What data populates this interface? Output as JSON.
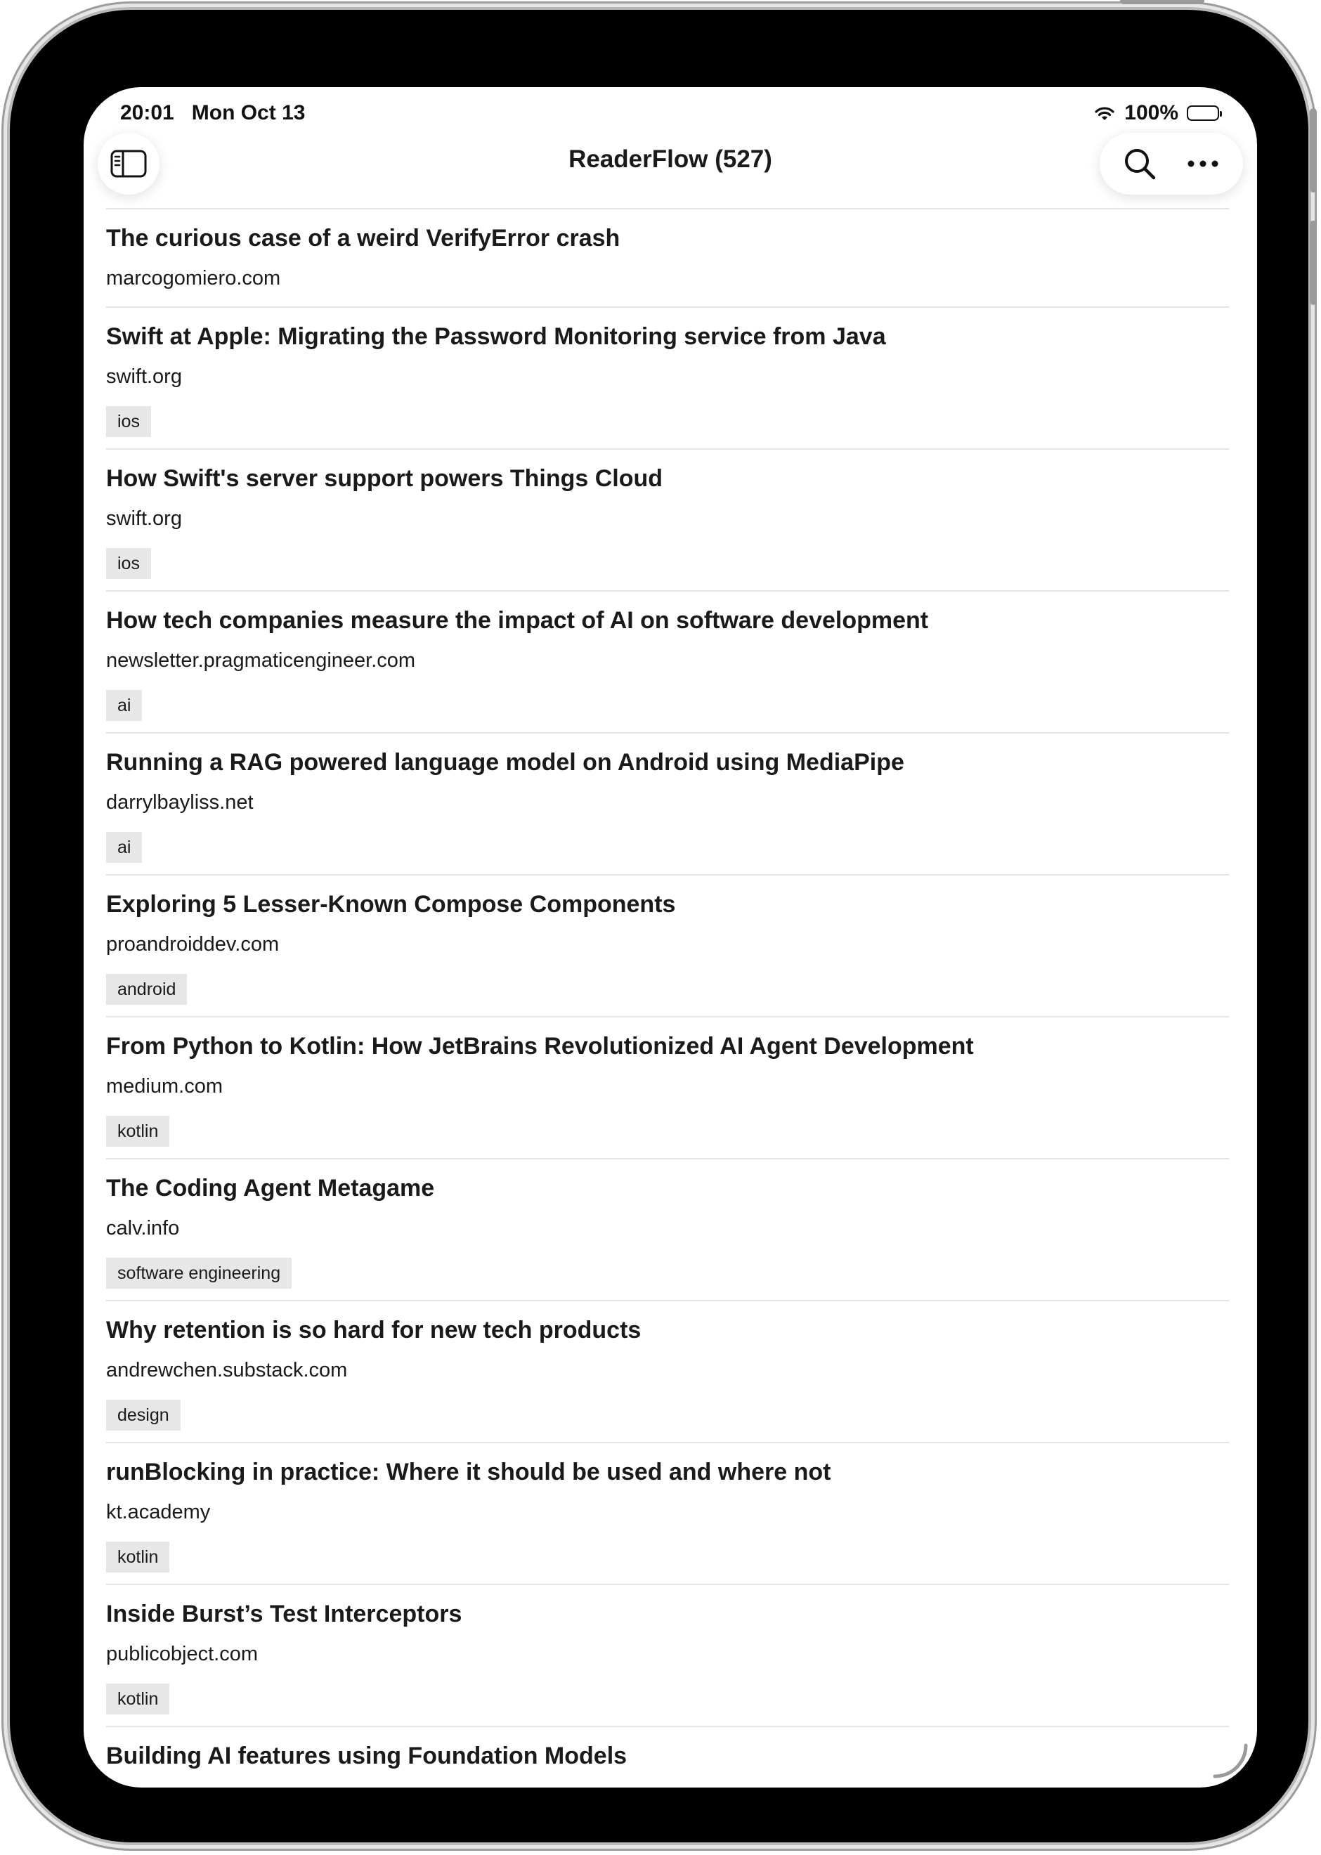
{
  "status_bar": {
    "time": "20:01",
    "date": "Mon Oct 13",
    "battery": "100%",
    "icons": [
      "wifi-icon",
      "battery-icon"
    ]
  },
  "toolbar": {
    "title": "ReaderFlow (527)",
    "buttons": [
      "sidebar-toggle-icon",
      "search-icon",
      "more-icon"
    ]
  },
  "articles": [
    {
      "title": "The curious case of a weird VerifyError crash",
      "domain": "marcogomiero.com"
    },
    {
      "title": "Swift at Apple: Migrating the Password Monitoring service from Java",
      "domain": "swift.org",
      "tag": "ios"
    },
    {
      "title": "How Swift's server support powers Things Cloud",
      "domain": "swift.org",
      "tag": "ios"
    },
    {
      "title": "How tech companies measure the impact of AI on software development",
      "domain": "newsletter.pragmaticengineer.com",
      "tag": "ai"
    },
    {
      "title": "Running a RAG powered language model on Android using MediaPipe",
      "domain": "darrylbayliss.net",
      "tag": "ai"
    },
    {
      "title": "Exploring 5 Lesser-Known Compose Components",
      "domain": "proandroiddev.com",
      "tag": "android"
    },
    {
      "title": "From Python to Kotlin: How JetBrains Revolutionized AI Agent Development",
      "domain": "medium.com",
      "tag": "kotlin"
    },
    {
      "title": "The Coding Agent Metagame",
      "domain": "calv.info",
      "tag": "software engineering"
    },
    {
      "title": "Why retention is so hard for new tech products",
      "domain": "andrewchen.substack.com",
      "tag": "design"
    },
    {
      "title": "runBlocking in practice: Where it should be used and where not",
      "domain": "kt.academy",
      "tag": "kotlin"
    },
    {
      "title": "Inside Burst’s Test Interceptors",
      "domain": "publicobject.com",
      "tag": "kotlin"
    },
    {
      "title": "Building AI features using Foundation Models"
    }
  ]
}
